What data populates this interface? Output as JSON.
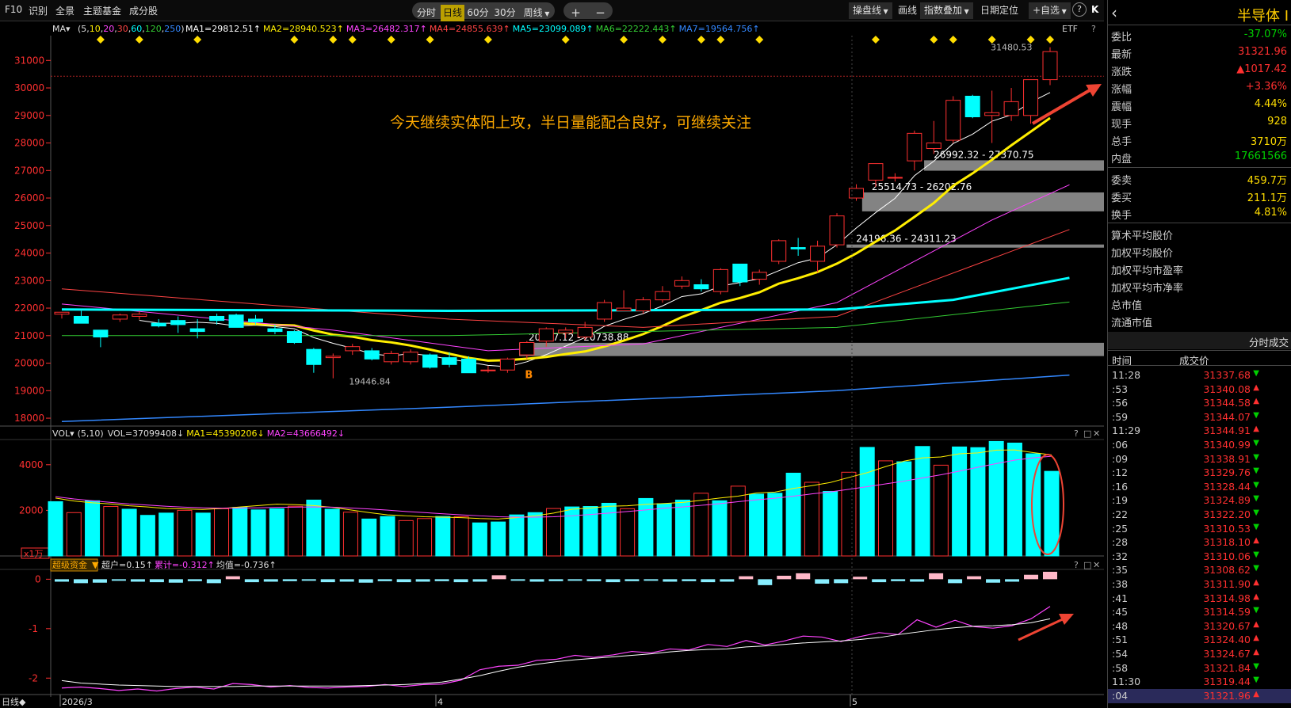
{
  "toolbar": {
    "f10": "F10",
    "shibie": "识别",
    "quanjing": "全景",
    "zhuti": "主题基金",
    "chengfen": "成分股",
    "periods": [
      "分时",
      "日线",
      "60分",
      "30分",
      "周线"
    ],
    "selected_period": "日线",
    "zoom_in": "+",
    "zoom_out": "−",
    "right": [
      "操盘线",
      "画线",
      "指数叠加",
      "日期定位",
      "+自选"
    ],
    "help": "?",
    "collapse": "K"
  },
  "ma_header": {
    "name": "MA▾",
    "params_prefix": "(5,",
    "params": [
      "10",
      "20",
      "30",
      "60",
      "120",
      "250"
    ],
    "items": [
      {
        "label": "MA1=29812.51↑",
        "color": "#ffffff"
      },
      {
        "label": "MA2=28940.523↑",
        "color": "#ffee00"
      },
      {
        "label": "MA3=26482.317↑",
        "color": "#ff44ff"
      },
      {
        "label": "MA4=24855.639↑",
        "color": "#ff4444"
      },
      {
        "label": "MA5=23099.089↑",
        "color": "#00ffff"
      },
      {
        "label": "MA6=22222.443↑",
        "color": "#33cc33"
      },
      {
        "label": "MA7=19564.756↑",
        "color": "#3388ff"
      }
    ],
    "etf": "ETF",
    "help": "?"
  },
  "main_chart": {
    "y_ticks": [
      "31000",
      "30000",
      "29000",
      "28000",
      "27000",
      "26000",
      "25000",
      "24000",
      "23000",
      "22000",
      "21000",
      "20000",
      "19000",
      "18000"
    ],
    "ylim": [
      17800,
      31900
    ],
    "annotation": "今天继续实体阳上攻，半日量能配合良好，可继续关注",
    "gap_labels": [
      "26992.32 - 27370.75",
      "25514.73 - 26202.76",
      "24196.36 - 24311.23",
      "20257.12 - 20738.88"
    ],
    "max_label": "31480.53",
    "min_label": "19446.84",
    "b_marker": "B"
  },
  "candles": [
    [
      21780,
      21850,
      21620,
      21850
    ],
    [
      21700,
      21900,
      21450,
      21450
    ],
    [
      21200,
      21200,
      20580,
      20950
    ],
    [
      21600,
      21800,
      21500,
      21750
    ],
    [
      21700,
      21900,
      21580,
      21780
    ],
    [
      21450,
      21600,
      21300,
      21350
    ],
    [
      21550,
      21700,
      21100,
      21400
    ],
    [
      21250,
      21600,
      20900,
      21150
    ],
    [
      21700,
      21800,
      21400,
      21550
    ],
    [
      21750,
      21800,
      21350,
      21300
    ],
    [
      21600,
      21750,
      21400,
      21500
    ],
    [
      21250,
      21400,
      21050,
      21150
    ],
    [
      21150,
      21200,
      20700,
      20750
    ],
    [
      20500,
      20550,
      19650,
      19950
    ],
    [
      20200,
      20350,
      19450,
      20250
    ],
    [
      20450,
      20700,
      20300,
      20600
    ],
    [
      20450,
      20550,
      20100,
      20150
    ],
    [
      20050,
      20450,
      19950,
      20350
    ],
    [
      20050,
      20500,
      19950,
      20400
    ],
    [
      20300,
      20350,
      19800,
      19850
    ],
    [
      20200,
      20400,
      19850,
      19950
    ],
    [
      20150,
      20250,
      19650,
      19650
    ],
    [
      19750,
      19900,
      19650,
      19750
    ],
    [
      19750,
      20200,
      19650,
      20150
    ],
    [
      20300,
      20800,
      20150,
      20750
    ],
    [
      20800,
      21300,
      20600,
      21250
    ],
    [
      21100,
      21300,
      20900,
      21200
    ],
    [
      20950,
      21500,
      20850,
      21300
    ],
    [
      21600,
      22300,
      21500,
      22200
    ],
    [
      21900,
      22650,
      21900,
      22000
    ],
    [
      21900,
      22400,
      21800,
      22300
    ],
    [
      22300,
      22800,
      22200,
      22600
    ],
    [
      22800,
      23150,
      22700,
      23000
    ],
    [
      22850,
      23050,
      22600,
      22700
    ],
    [
      22600,
      23450,
      22500,
      23400
    ],
    [
      23600,
      23600,
      22800,
      22950
    ],
    [
      23050,
      23400,
      22850,
      23300
    ],
    [
      23700,
      24500,
      23600,
      24450
    ],
    [
      24200,
      24550,
      23900,
      24150
    ],
    [
      23700,
      24450,
      23300,
      24250
    ],
    [
      24300,
      25450,
      24200,
      25350
    ],
    [
      26000,
      26500,
      25900,
      26350
    ],
    [
      26650,
      27250,
      26400,
      27250
    ],
    [
      26750,
      26900,
      26600,
      26750
    ],
    [
      27350,
      28450,
      27000,
      28350
    ],
    [
      27800,
      28800,
      27600,
      28000
    ],
    [
      28100,
      29700,
      28000,
      29550
    ],
    [
      29700,
      29750,
      28900,
      28950
    ],
    [
      29000,
      29900,
      28000,
      29100
    ],
    [
      29000,
      30000,
      28800,
      29500
    ],
    [
      29000,
      30300,
      28700,
      30300
    ],
    [
      30300,
      31480,
      30100,
      31320
    ]
  ],
  "vol_header": {
    "name": "VOL▾",
    "params": "(5,10)",
    "vol": "VOL=37099408↓",
    "ma1": "MA1=45390206↓",
    "ma2": "MA2=43666492↓",
    "help": "?"
  },
  "volume_chart": {
    "y_ticks": [
      "4000",
      "2000"
    ],
    "unit": "x1万",
    "ylim": [
      0,
      5000
    ],
    "values": [
      2380,
      1900,
      2420,
      2170,
      2050,
      1780,
      1880,
      2000,
      1880,
      2070,
      2130,
      2020,
      2070,
      2180,
      2450,
      2050,
      1920,
      1620,
      1730,
      1550,
      1640,
      1730,
      1720,
      1450,
      1490,
      1800,
      1900,
      2080,
      2150,
      2170,
      2310,
      2070,
      2520,
      2290,
      2450,
      2750,
      2420,
      3060,
      2710,
      2750,
      3630,
      3230,
      2830,
      3670,
      4760,
      4170,
      4130,
      4800,
      3980,
      4780,
      4750,
      5020,
      4950,
      4480,
      3710
    ],
    "ma5": [
      2540,
      2410,
      2330,
      2280,
      2200,
      2150,
      2080,
      2060,
      2040,
      2080,
      2150,
      2210,
      2270,
      2250,
      2210,
      2130,
      2020,
      1900,
      1800,
      1760,
      1720,
      1700,
      1680,
      1640,
      1620,
      1680,
      1760,
      1880,
      2050,
      2100,
      2180,
      2200,
      2260,
      2300,
      2350,
      2440,
      2540,
      2620,
      2760,
      2800,
      2960,
      3080,
      3220,
      3440,
      3650,
      3920,
      4160,
      4300,
      4340,
      4480,
      4520,
      4640,
      4650,
      4530,
      4430
    ],
    "ma10": [
      2600,
      2500,
      2420,
      2350,
      2280,
      2230,
      2180,
      2140,
      2110,
      2090,
      2100,
      2110,
      2130,
      2140,
      2150,
      2140,
      2100,
      2060,
      2010,
      1950,
      1900,
      1850,
      1800,
      1760,
      1720,
      1700,
      1700,
      1720,
      1760,
      1820,
      1880,
      1950,
      2020,
      2090,
      2150,
      2220,
      2290,
      2380,
      2460,
      2530,
      2620,
      2720,
      2810,
      2920,
      3040,
      3160,
      3280,
      3420,
      3560,
      3720,
      3890,
      4050,
      4200,
      4300,
      4370
    ]
  },
  "fund_header": {
    "name": "超级资金",
    "super": "超户=0.15↑",
    "cum": "累计=-0.312↑",
    "avg": "均值=-0.736↑",
    "help": "?"
  },
  "fund_chart": {
    "y_ticks": [
      "0",
      "-1",
      "-2"
    ],
    "ylim": [
      -2.3,
      0.15
    ],
    "bars": [
      -0.05,
      -0.08,
      -0.07,
      -0.02,
      -0.05,
      -0.06,
      -0.07,
      -0.04,
      -0.08,
      0.06,
      -0.06,
      -0.05,
      -0.04,
      -0.03,
      -0.06,
      -0.05,
      -0.07,
      -0.04,
      -0.06,
      -0.05,
      -0.04,
      -0.06,
      -0.05,
      0.08,
      -0.03,
      -0.05,
      -0.04,
      -0.03,
      -0.04,
      -0.06,
      -0.04,
      -0.03,
      -0.05,
      -0.04,
      -0.06,
      -0.05,
      0.06,
      -0.12,
      0.07,
      0.12,
      -0.09,
      -0.08,
      0.05,
      -0.06,
      -0.04,
      -0.05,
      0.12,
      -0.08,
      0.06,
      -0.07,
      -0.05,
      0.09,
      0.15
    ],
    "cum": [
      -2.2,
      -2.18,
      -2.21,
      -2.25,
      -2.22,
      -2.26,
      -2.21,
      -2.18,
      -2.22,
      -2.11,
      -2.13,
      -2.18,
      -2.15,
      -2.19,
      -2.2,
      -2.18,
      -2.17,
      -2.13,
      -2.17,
      -2.13,
      -2.12,
      -2.04,
      -1.83,
      -1.76,
      -1.74,
      -1.64,
      -1.62,
      -1.54,
      -1.58,
      -1.53,
      -1.46,
      -1.49,
      -1.41,
      -1.43,
      -1.32,
      -1.36,
      -1.24,
      -1.33,
      -1.25,
      -1.15,
      -1.17,
      -1.26,
      -1.16,
      -1.08,
      -1.12,
      -0.82,
      -0.97,
      -0.83,
      -0.96,
      -0.99,
      -0.94,
      -0.8,
      -0.55
    ],
    "avg": [
      -2.05,
      -2.1,
      -2.12,
      -2.14,
      -2.15,
      -2.16,
      -2.17,
      -2.17,
      -2.17,
      -2.17,
      -2.16,
      -2.16,
      -2.16,
      -2.16,
      -2.16,
      -2.16,
      -2.15,
      -2.14,
      -2.13,
      -2.11,
      -2.08,
      -2.02,
      -1.95,
      -1.86,
      -1.78,
      -1.72,
      -1.67,
      -1.63,
      -1.6,
      -1.57,
      -1.54,
      -1.51,
      -1.47,
      -1.44,
      -1.42,
      -1.41,
      -1.37,
      -1.35,
      -1.32,
      -1.29,
      -1.27,
      -1.25,
      -1.22,
      -1.18,
      -1.12,
      -1.07,
      -1.02,
      -0.98,
      -0.95,
      -0.94,
      -0.92,
      -0.88,
      -0.8
    ]
  },
  "x_axis": {
    "labels": [
      "2026/3",
      "4",
      "5"
    ],
    "corner": "日线◆"
  },
  "sidebar": {
    "title": "半导体 I",
    "stats": [
      {
        "k": "委比",
        "v": "-37.07%",
        "c": "dn"
      },
      {
        "k": "最新",
        "v": "31321.96",
        "c": "up"
      },
      {
        "k": "涨跌",
        "v": "▲1017.42",
        "c": "up"
      },
      {
        "k": "涨幅",
        "v": "+3.36%",
        "c": "up"
      },
      {
        "k": "震幅",
        "v": "4.44%",
        "c": "yel"
      },
      {
        "k": "现手",
        "v": "928",
        "c": "yel"
      },
      {
        "k": "总手",
        "v": "3710万",
        "c": "yel"
      },
      {
        "k": "内盘",
        "v": "17661566",
        "c": "dn"
      }
    ],
    "stats2": [
      {
        "k": "委卖",
        "v": "459.7万",
        "c": "yel"
      },
      {
        "k": "委买",
        "v": "211.1万",
        "c": "yel"
      },
      {
        "k": "换手",
        "v": "4.81%",
        "c": "yel"
      }
    ],
    "links": [
      "算术平均股价",
      "加权平均股价",
      "加权平均市盈率",
      "加权平均市净率",
      "总市值",
      "流通市值"
    ],
    "section": "分时成交",
    "cols": [
      "时间",
      "成交价"
    ],
    "ticks": [
      {
        "t": "11:28",
        "p": "31337.68",
        "d": "dn"
      },
      {
        "t": ":53",
        "p": "31340.08",
        "d": "up"
      },
      {
        "t": ":56",
        "p": "31344.58",
        "d": "up"
      },
      {
        "t": ":59",
        "p": "31344.07",
        "d": "dn"
      },
      {
        "t": "11:29",
        "p": "31344.91",
        "d": "up"
      },
      {
        "t": ":06",
        "p": "31340.99",
        "d": "dn"
      },
      {
        "t": ":09",
        "p": "31338.91",
        "d": "dn"
      },
      {
        "t": ":12",
        "p": "31329.76",
        "d": "dn"
      },
      {
        "t": ":16",
        "p": "31328.44",
        "d": "dn"
      },
      {
        "t": ":19",
        "p": "31324.89",
        "d": "dn"
      },
      {
        "t": ":22",
        "p": "31322.20",
        "d": "dn"
      },
      {
        "t": ":25",
        "p": "31310.53",
        "d": "dn"
      },
      {
        "t": ":28",
        "p": "31318.10",
        "d": "up"
      },
      {
        "t": ":32",
        "p": "31310.06",
        "d": "dn"
      },
      {
        "t": ":35",
        "p": "31308.62",
        "d": "dn"
      },
      {
        "t": ":38",
        "p": "31311.90",
        "d": "up"
      },
      {
        "t": ":41",
        "p": "31314.98",
        "d": "up"
      },
      {
        "t": ":45",
        "p": "31314.59",
        "d": "dn"
      },
      {
        "t": ":48",
        "p": "31320.67",
        "d": "up"
      },
      {
        "t": ":51",
        "p": "31324.40",
        "d": "up"
      },
      {
        "t": ":54",
        "p": "31324.67",
        "d": "up"
      },
      {
        "t": ":58",
        "p": "31321.84",
        "d": "dn"
      },
      {
        "t": "11:30",
        "p": "31319.44",
        "d": "dn"
      },
      {
        "t": ":04",
        "p": "31321.96",
        "d": "up"
      }
    ]
  }
}
